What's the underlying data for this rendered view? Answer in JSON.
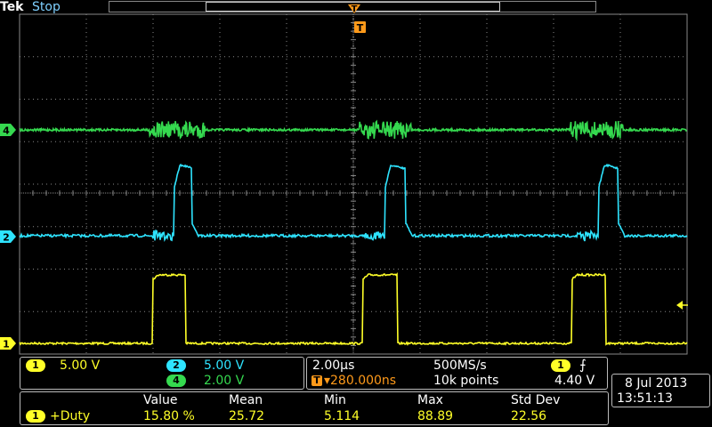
{
  "header": {
    "brand": "Tek",
    "run_state": "Stop"
  },
  "markers": {
    "trigger_top": "T",
    "channels": [
      {
        "id": "4",
        "label": "4",
        "color": "#35d94f"
      },
      {
        "id": "2",
        "label": "2",
        "color": "#2ee4ff"
      },
      {
        "id": "1",
        "label": "1",
        "color": "#ffff28"
      }
    ]
  },
  "vertical": {
    "ch1": {
      "badge": "1",
      "scale": "5.00 V",
      "color": "#ffff28"
    },
    "ch2": {
      "badge": "2",
      "scale": "5.00 V",
      "color": "#2ee4ff"
    },
    "ch4": {
      "badge": "4",
      "scale": "2.00 V",
      "color": "#35d94f"
    }
  },
  "horizontal": {
    "time_div": "2.00µs",
    "sample_rate": "500MS/s",
    "trigger_delay": "▾280.000ns",
    "trigger_delay_icon": "T",
    "record_length": "10k points",
    "trigger_source": "1",
    "trigger_slope_icon": "rising-edge-icon",
    "trigger_slope_glyph": "⨍",
    "trigger_level": "4.40 V"
  },
  "datetime": {
    "date": "8 Jul  2013",
    "time": "13:51:13"
  },
  "measurement": {
    "headers": [
      "Value",
      "Mean",
      "Min",
      "Max",
      "Std Dev"
    ],
    "rows": [
      {
        "badge": "1",
        "name": "+Duty",
        "values": [
          "15.80 %",
          "25.72",
          "5.114",
          "88.89",
          "22.56"
        ]
      }
    ]
  },
  "colors": {
    "ch1": "#ffff28",
    "ch2": "#2ee4ff",
    "ch4": "#35d94f",
    "trigger": "#ff9a1a",
    "grid": "#888888"
  }
}
